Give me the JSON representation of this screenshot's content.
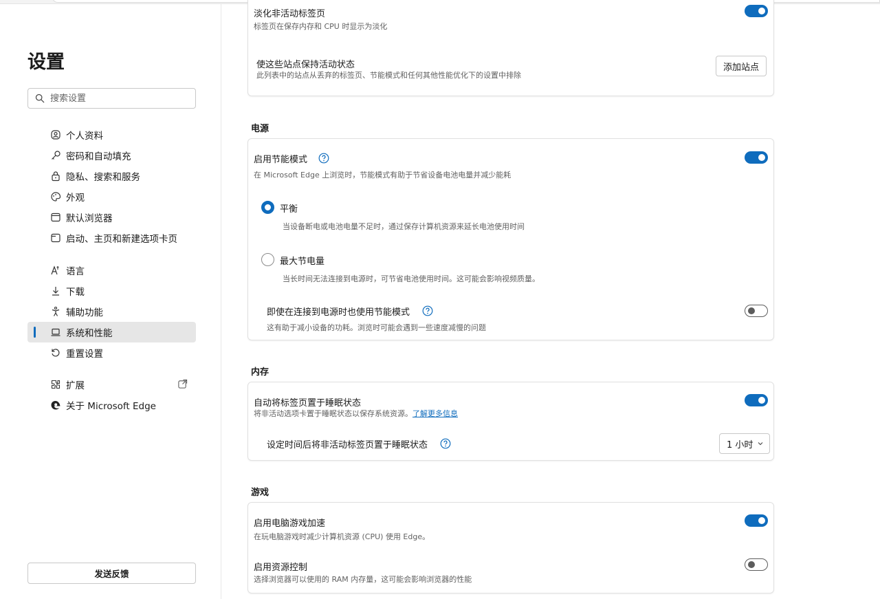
{
  "sidebar": {
    "title": "设置",
    "search_placeholder": "搜索设置",
    "items": [
      {
        "label": "个人资料",
        "icon": "profile-icon"
      },
      {
        "label": "密码和自动填充",
        "icon": "key-icon"
      },
      {
        "label": "隐私、搜索和服务",
        "icon": "lock-icon"
      },
      {
        "label": "外观",
        "icon": "palette-icon"
      },
      {
        "label": "默认浏览器",
        "icon": "browser-icon"
      },
      {
        "label": "启动、主页和新建选项卡页",
        "icon": "home-tab-icon"
      },
      {
        "label": "语言",
        "icon": "language-icon"
      },
      {
        "label": "下载",
        "icon": "download-icon"
      },
      {
        "label": "辅助功能",
        "icon": "accessibility-icon"
      },
      {
        "label": "系统和性能",
        "icon": "laptop-icon",
        "active": true
      },
      {
        "label": "重置设置",
        "icon": "reset-icon"
      },
      {
        "label": "扩展",
        "icon": "extensions-icon"
      },
      {
        "label": "关于 Microsoft Edge",
        "icon": "edge-icon"
      }
    ],
    "feedback_label": "发送反馈"
  },
  "performance": {
    "fade_title": "淡化非活动标签页",
    "fade_desc": "标签页在保存内存和 CPU 时显示为淡化",
    "fade_on": true,
    "keep_active_title": "使这些站点保持活动状态",
    "keep_active_desc": "此列表中的站点从丢弃的标签页、节能模式和任何其他性能优化下的设置中排除",
    "add_site_label": "添加站点"
  },
  "power": {
    "section_title": "电源",
    "efficiency_title": "启用节能模式",
    "efficiency_desc": "在 Microsoft Edge 上浏览时，节能模式有助于节省设备电池电量并减少能耗",
    "efficiency_on": true,
    "balanced_label": "平衡",
    "balanced_desc": "当设备断电或电池电量不足时，通过保存计算机资源来延长电池使用时间",
    "max_label": "最大节电量",
    "max_desc": "当长时间无法连接到电源时，可节省电池使用时间。这可能会影响视频质量。",
    "plugged_title": "即使在连接到电源时也使用节能模式",
    "plugged_desc": "这有助于减小设备的功耗。浏览时可能会遇到一些速度减慢的问题",
    "plugged_on": false
  },
  "memory": {
    "section_title": "内存",
    "sleep_title": "自动将标签页置于睡眠状态",
    "sleep_desc": "将非活动选项卡置于睡眠状态以保存系统资源。",
    "sleep_link": "了解更多信息",
    "sleep_on": true,
    "timeout_title": "设定时间后将非活动标签页置于睡眠状态",
    "timeout_value": "1 小时"
  },
  "gaming": {
    "section_title": "游戏",
    "boost_title": "启用电脑游戏加速",
    "boost_desc": "在玩电脑游戏时减少计算机资源 (CPU) 使用 Edge。",
    "boost_on": true,
    "resource_title": "启用资源控制",
    "resource_desc": "选择浏览器可以使用的 RAM 内存量，这可能会影响浏览器的性能",
    "resource_on": false
  },
  "colors": {
    "accent": "#0f6cbd"
  }
}
